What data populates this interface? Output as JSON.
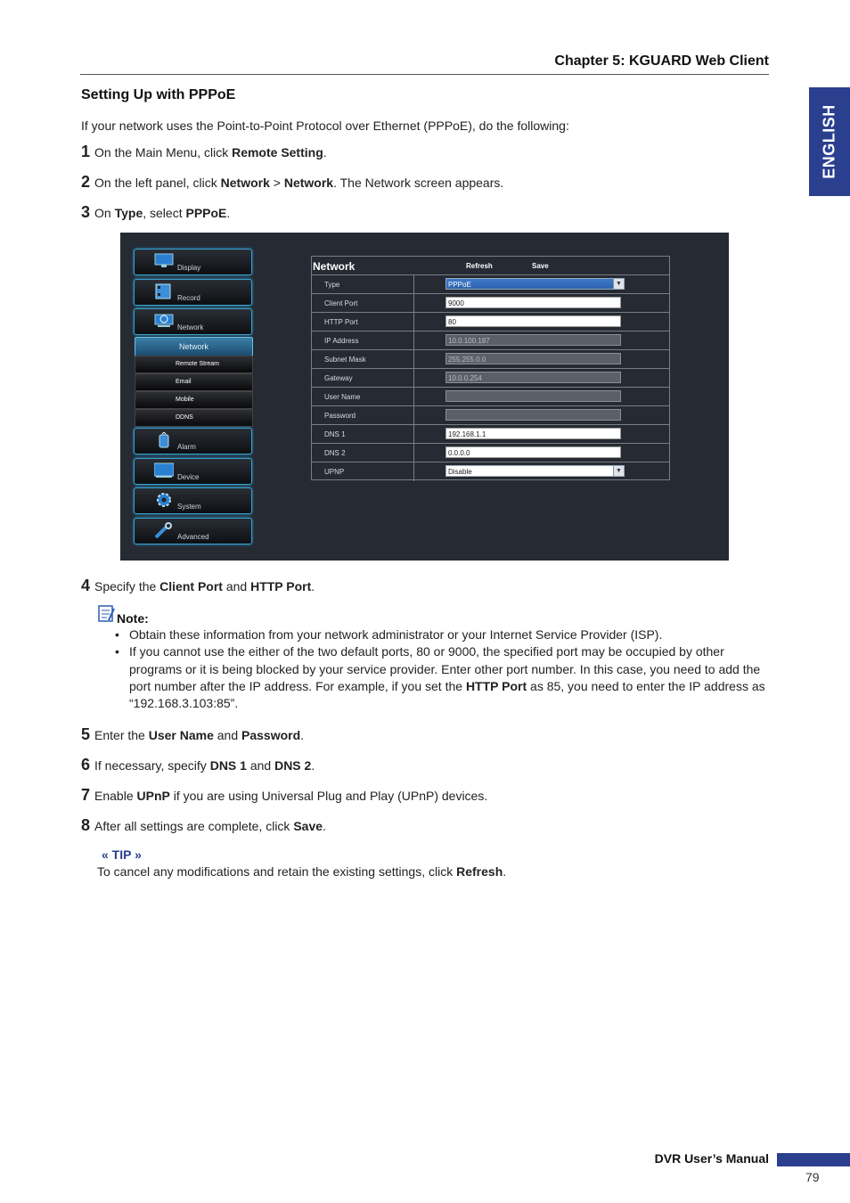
{
  "header": {
    "chapter": "Chapter 5: KGUARD Web Client",
    "lang_tab": "ENGLISH"
  },
  "section": {
    "title": "Setting Up with PPPoE",
    "intro": "If your network uses the Point-to-Point Protocol over Ethernet (PPPoE), do the following:"
  },
  "steps": {
    "s1": {
      "num": "1",
      "a": "On the Main Menu, click ",
      "b": "Remote Setting",
      "c": "."
    },
    "s2": {
      "num": "2",
      "a": "On the left panel, click ",
      "b": "Network",
      "c": " > ",
      "d": "Network",
      "e": ". The Network screen appears."
    },
    "s3": {
      "num": "3",
      "a": "On ",
      "b": "Type",
      "c": ", select ",
      "d": "PPPoE",
      "e": "."
    },
    "s4": {
      "num": "4",
      "a": "Specify the ",
      "b": "Client Port",
      "c": " and ",
      "d": "HTTP Port",
      "e": "."
    },
    "s5": {
      "num": "5",
      "a": "Enter the ",
      "b": "User Name",
      "c": " and ",
      "d": "Password",
      "e": "."
    },
    "s6": {
      "num": "6",
      "a": "If necessary, specify ",
      "b": "DNS 1",
      "c": " and ",
      "d": "DNS 2",
      "e": "."
    },
    "s7": {
      "num": "7",
      "a": "Enable ",
      "b": "UPnP",
      "c": " if you are using Universal Plug and Play (UPnP) devices."
    },
    "s8": {
      "num": "8",
      "a": "After all settings are complete, click ",
      "b": "Save",
      "c": "."
    }
  },
  "screenshot": {
    "menu": {
      "display": "Display",
      "record": "Record",
      "network": "Network",
      "sub_network": "Network",
      "sub_remote_stream": "Remote Stream",
      "sub_email": "Email",
      "sub_mobile": "Mobile",
      "sub_ddns": "DDNS",
      "alarm": "Alarm",
      "device": "Device",
      "system": "System",
      "advanced": "Advanced"
    },
    "panel": {
      "title": "Network",
      "refresh": "Refresh",
      "save": "Save",
      "rows": [
        {
          "label": "Type",
          "value": "PPPoE"
        },
        {
          "label": "Client Port",
          "value": "9000"
        },
        {
          "label": "HTTP Port",
          "value": "80"
        },
        {
          "label": "IP Address",
          "value": "10.0.100.187"
        },
        {
          "label": "Subnet Mask",
          "value": "255.255.0.0"
        },
        {
          "label": "Gateway",
          "value": "10.0.0.254"
        },
        {
          "label": "User Name",
          "value": ""
        },
        {
          "label": "Password",
          "value": ""
        },
        {
          "label": "DNS 1",
          "value": "192.168.1.1"
        },
        {
          "label": "DNS 2",
          "value": "0.0.0.0"
        },
        {
          "label": "UPNP",
          "value": "Disable"
        }
      ]
    }
  },
  "note": {
    "label": "Note:",
    "b1": "Obtain these information from your network administrator or your Internet Service Provider (ISP).",
    "b2a": "If you cannot use the either of the two default ports, 80 or 9000, the specified port may be occupied by other programs or it is being blocked by your service provider. Enter other port number. In this case, you need to add the port number after the IP address. For example, if you set the ",
    "b2b": "HTTP Port",
    "b2c": " as 85, you need to enter the IP address as “192.168.3.103:85”."
  },
  "tip": {
    "label": "« TIP »",
    "a": "To cancel any modifications and retain the existing settings, click ",
    "b": "Refresh",
    "c": "."
  },
  "footer": {
    "title": "DVR User’s Manual",
    "page": "79"
  },
  "colors": {
    "accent": "#2b3f8f",
    "dvr_bg": "#252a33",
    "menu_glow": "#3aa2d0"
  }
}
